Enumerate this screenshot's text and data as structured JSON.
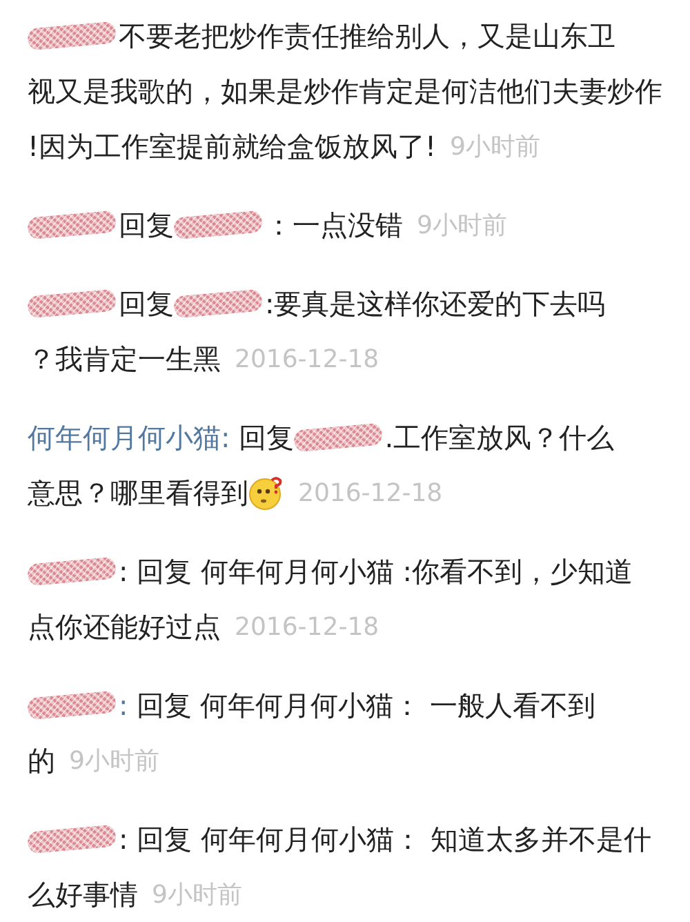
{
  "comments": [
    {
      "lines": [
        [
          {
            "kind": "redacted"
          },
          {
            "kind": "text",
            "text": "不要老把炒作责任推给别人，又是山东卫"
          }
        ],
        [
          {
            "kind": "text",
            "text": "视又是我歌的，如果是炒作肯定是何洁他们夫妻炒作"
          }
        ],
        [
          {
            "kind": "text",
            "text": "!因为工作室提前就给盒饭放风了!"
          },
          {
            "kind": "time",
            "text": "9小时前"
          }
        ]
      ]
    },
    {
      "lines": [
        [
          {
            "kind": "redacted"
          },
          {
            "kind": "text",
            "text": "回复 "
          },
          {
            "kind": "redacted"
          },
          {
            "kind": "text",
            "text": "：一点没错"
          },
          {
            "kind": "time",
            "text": "9小时前"
          }
        ]
      ]
    },
    {
      "lines": [
        [
          {
            "kind": "redacted"
          },
          {
            "kind": "text",
            "text": "回复 "
          },
          {
            "kind": "redacted"
          },
          {
            "kind": "text",
            "text": ":要真是这样你还爱的下去吗"
          }
        ],
        [
          {
            "kind": "text",
            "text": "？我肯定一生黑"
          },
          {
            "kind": "time",
            "text": "2016-12-18"
          }
        ]
      ]
    },
    {
      "lines": [
        [
          {
            "kind": "author",
            "text": "何年何月何小猫:"
          },
          {
            "kind": "text",
            "text": "回复 "
          },
          {
            "kind": "redacted"
          },
          {
            "kind": "text",
            "text": ".工作室放风？什么"
          }
        ],
        [
          {
            "kind": "text",
            "text": "意思？哪里看得到"
          },
          {
            "kind": "emoji"
          },
          {
            "kind": "time",
            "text": "2016-12-18"
          }
        ]
      ]
    },
    {
      "lines": [
        [
          {
            "kind": "redacted"
          },
          {
            "kind": "text",
            "text": ": 回复 何年何月何小猫 :你看不到，少知道"
          }
        ],
        [
          {
            "kind": "text",
            "text": "点你还能好过点"
          },
          {
            "kind": "time",
            "text": "2016-12-18"
          }
        ]
      ]
    },
    {
      "lines": [
        [
          {
            "kind": "redacted"
          },
          {
            "kind": "author",
            "text": ":"
          },
          {
            "kind": "text",
            "text": "回复 何年何月何小猫： 一般人看不到"
          }
        ],
        [
          {
            "kind": "text",
            "text": "的"
          },
          {
            "kind": "time",
            "text": "9小时前"
          }
        ]
      ]
    },
    {
      "lines": [
        [
          {
            "kind": "redacted"
          },
          {
            "kind": "text",
            "text": ": 回复 何年何月何小猫： 知道太多并不是什"
          }
        ],
        [
          {
            "kind": "text",
            "text": "么好事情"
          },
          {
            "kind": "time",
            "text": "9小时前"
          }
        ]
      ]
    }
  ]
}
